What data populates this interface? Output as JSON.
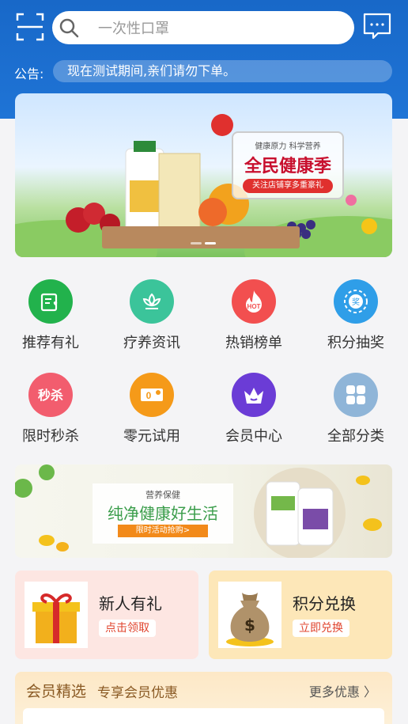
{
  "search": {
    "placeholder": "一次性口罩"
  },
  "notice": {
    "label": "公告:",
    "text": "现在测试期间,亲们请勿下单。"
  },
  "banner": {
    "line1": "健康原力 科学营养",
    "title": "全民健康季",
    "button": "关注店铺享多重豪礼"
  },
  "nav": [
    {
      "label": "推荐有礼",
      "icon": "gift-card-icon",
      "color": "#22b24c"
    },
    {
      "label": "疗养资讯",
      "icon": "lotus-icon",
      "color": "#3bc49a"
    },
    {
      "label": "热销榜单",
      "icon": "hot-icon",
      "color": "#f24f4f"
    },
    {
      "label": "积分抽奖",
      "icon": "lottery-wheel-icon",
      "color": "#2f9ee8"
    },
    {
      "label": "限时秒杀",
      "icon": "flash-sale-icon",
      "color": "#f25d6e"
    },
    {
      "label": "零元试用",
      "icon": "zero-trial-icon",
      "color": "#f59a19"
    },
    {
      "label": "会员中心",
      "icon": "crown-icon",
      "color": "#6b3cd6"
    },
    {
      "label": "全部分类",
      "icon": "grid-icon",
      "color": "#8fb5d8"
    }
  ],
  "promo": {
    "small": "营养保健",
    "title": "纯净健康好生活",
    "button": "限时活动抢购>"
  },
  "cards": [
    {
      "title": "新人有礼",
      "button": "点击领取",
      "color": "#fde6e2",
      "accent": "#e0442e"
    },
    {
      "title": "积分兑换",
      "button": "立即兑换",
      "color": "#fde7b8",
      "accent": "#e0442e"
    }
  ],
  "section": {
    "title": "会员精选",
    "subtitle": "专享会员优惠",
    "more": "更多优惠 〉"
  }
}
